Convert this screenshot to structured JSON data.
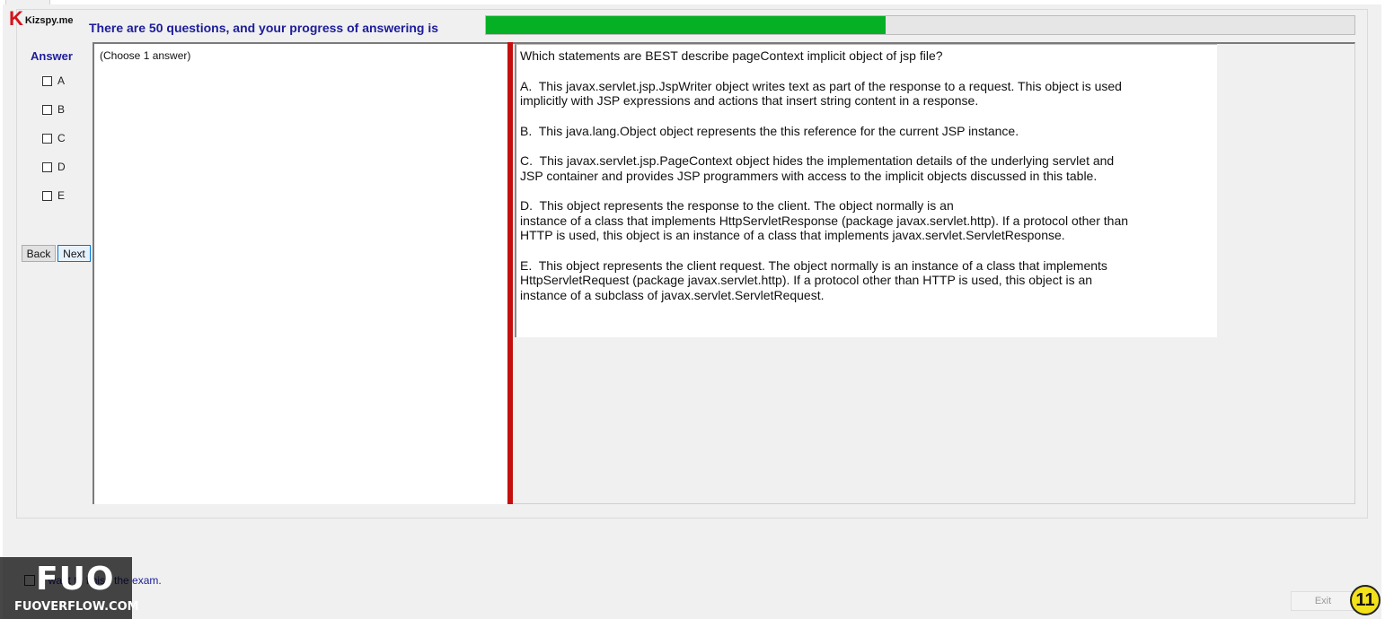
{
  "logo": {
    "letter": "K",
    "name": "Kizspy.me"
  },
  "progress": {
    "label": "There are 50 questions, and your progress of answering is",
    "fraction": 0.46,
    "fill_color": "#06b025"
  },
  "answer": {
    "title": "Answer",
    "options": [
      "A",
      "B",
      "C",
      "D",
      "E"
    ]
  },
  "nav": {
    "back_label": "Back",
    "next_label": "Next"
  },
  "choose": {
    "text": "(Choose 1 answer)"
  },
  "question": {
    "lines": [
      "Which statements are BEST describe pageContext implicit object of jsp file?",
      "",
      "A.  This javax.servlet.jsp.JspWriter object writes text as part of the response to a request. This object is used",
      "implicitly with JSP expressions and actions that insert string content in a response.",
      "",
      "B.  This java.lang.Object object represents the this reference for the current JSP instance.",
      "",
      "C.  This javax.servlet.jsp.PageContext object hides the implementation details of the underlying servlet and",
      "JSP container and provides JSP programmers with access to the implicit objects discussed in this table.",
      "",
      "D.  This object represents the response to the client. The object normally is an",
      "instance of a class that implements HttpServletResponse (package javax.servlet.http). If a protocol other than",
      "HTTP is used, this object is an instance of a class that implements javax.servlet.ServletResponse.",
      "",
      "E.  This object represents the client request. The object normally is an instance of a class that implements",
      "HttpServletRequest (package javax.servlet.http). If a protocol other than HTTP is used, this object is an",
      "instance of a subclass of javax.servlet.ServletRequest."
    ]
  },
  "finish": {
    "label": "I want to finish the exam."
  },
  "exit": {
    "label": "Exit"
  },
  "badge": {
    "number": "11"
  },
  "watermark": {
    "big": "FUO",
    "small": "FUOVERFLOW.COM"
  },
  "colors": {
    "accent_blue": "#1d1d9a",
    "splitter_red": "#c40f0f",
    "logo_red": "#d4141b"
  }
}
